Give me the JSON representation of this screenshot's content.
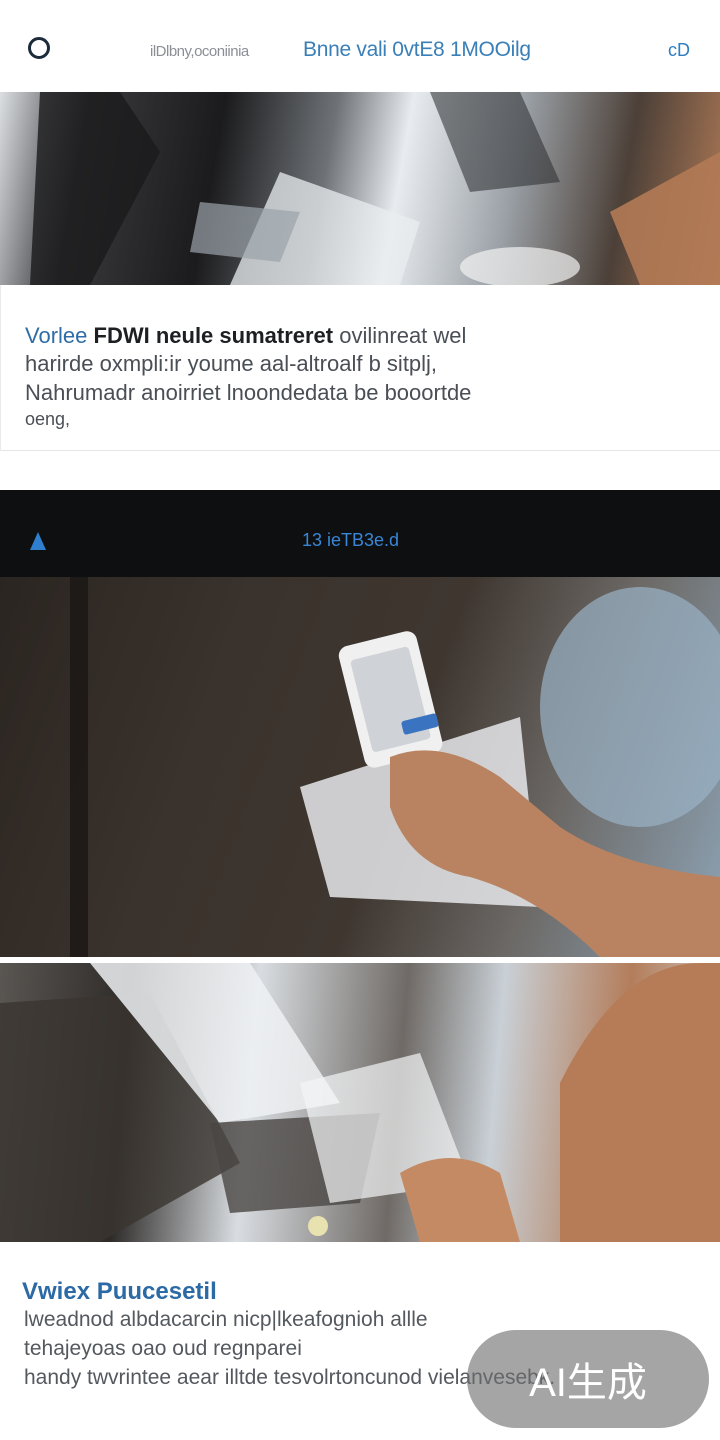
{
  "header": {
    "subtitle": "ilDlbny,oconiinia",
    "title": "Bnne vali 0vtE8 1MOOilg",
    "action_label": "cD"
  },
  "card_1": {
    "line1_blue": "Vorlee",
    "line1_dark": "FDWI neule sumatreret",
    "line1_rest": "ovilinreat wel",
    "line2": "harirde oxmpli:ir youme aal-altroalf b sitplj,",
    "line3": "Nahrumadr anoirriet lnoondedata be booortde",
    "line4": "oeng,"
  },
  "dark_bar": {
    "title": "13 ieTB3e.d"
  },
  "card_2": {
    "heading": "Vwiex Puucesetil",
    "line1": "lweadnod albdacarcin nicp|lkeafognioh allle",
    "line2": "tehajeyoas oao oud regnparei",
    "line3": "handy twvrintee aear illtde tesvolrtoncunod vielanvesebk."
  },
  "watermark": {
    "text": "AI生成"
  },
  "colors": {
    "accent": "#2e7dc2",
    "dark_bar": "#0e0f11",
    "watermark_bg": "#6e6e6e"
  },
  "icons": {
    "logo": "circle-logo-icon",
    "bar_icon": "bookmark-half-icon"
  }
}
